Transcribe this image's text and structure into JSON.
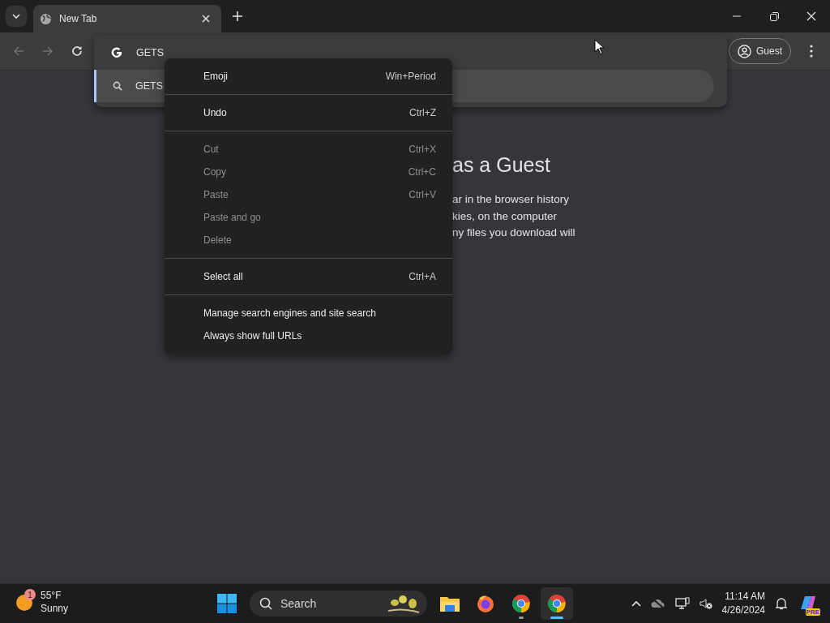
{
  "tabs": [
    {
      "title": "New Tab",
      "selected": true
    }
  ],
  "toolbar": {
    "back_disabled": true,
    "forward_disabled": true,
    "profile": "Guest"
  },
  "omnibox": {
    "value": "GETS",
    "suggestions": [
      {
        "text": "GETS",
        "selected": true
      }
    ]
  },
  "context_menu": {
    "groups": [
      [
        {
          "label": "Emoji",
          "shortcut": "Win+Period",
          "disabled": false
        }
      ],
      [
        {
          "label": "Undo",
          "shortcut": "Ctrl+Z",
          "disabled": false
        }
      ],
      [
        {
          "label": "Cut",
          "shortcut": "Ctrl+X",
          "disabled": true
        },
        {
          "label": "Copy",
          "shortcut": "Ctrl+C",
          "disabled": true
        },
        {
          "label": "Paste",
          "shortcut": "Ctrl+V",
          "disabled": true
        },
        {
          "label": "Paste and go",
          "disabled": true
        },
        {
          "label": "Delete",
          "disabled": true
        }
      ],
      [
        {
          "label": "Select all",
          "shortcut": "Ctrl+A",
          "disabled": false
        }
      ],
      [
        {
          "label": "Manage search engines and site search",
          "disabled": false
        },
        {
          "label": "Always show full URLs",
          "disabled": false
        }
      ]
    ]
  },
  "page": {
    "heading": "as a Guest",
    "lines": [
      "ar in the browser history",
      "kies, on the computer",
      "ny files you download will"
    ]
  },
  "taskbar": {
    "weather": {
      "temp": "55°F",
      "condition": "Sunny",
      "badge": "1"
    },
    "search": "Search",
    "apps": [
      {
        "kind": "files",
        "selected": false,
        "running": false
      },
      {
        "kind": "firefox",
        "selected": false,
        "running": false
      },
      {
        "kind": "chrome",
        "selected": false,
        "running": true
      },
      {
        "kind": "chrome",
        "selected": true,
        "running": true
      }
    ],
    "time": "11:14 AM",
    "date": "4/26/2024",
    "copilot_badge": "PRE"
  }
}
